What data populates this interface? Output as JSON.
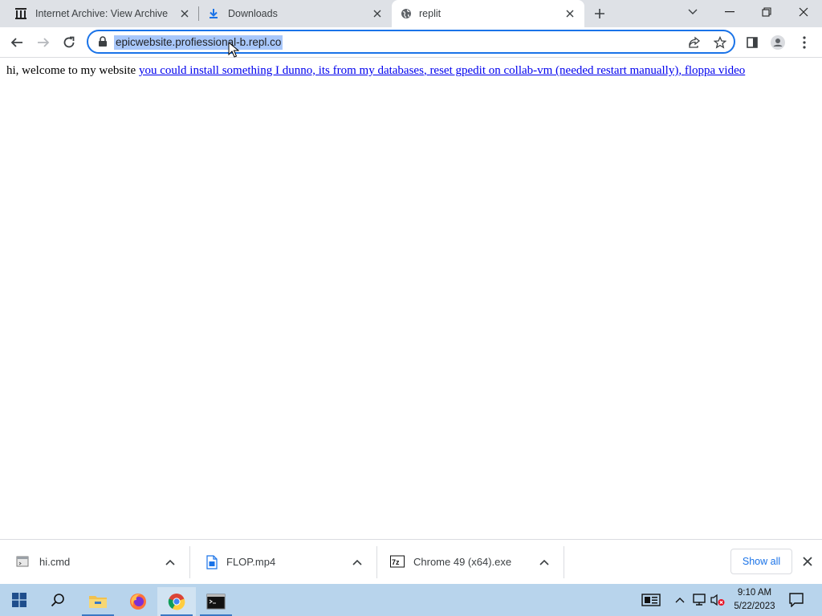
{
  "tabs": [
    {
      "title": "Internet Archive: View Archive",
      "icon": "archive-icon"
    },
    {
      "title": "Downloads",
      "icon": "download-icon"
    },
    {
      "title": "replit",
      "icon": "globe-icon",
      "active": true
    }
  ],
  "address_bar": {
    "url": "epicwebsite.profiessional-b.repl.co",
    "selected": true
  },
  "page": {
    "intro_text": "hi, welcome to my website",
    "links": [
      "you could install something I dunno, its from my databases",
      "reset gpedit on collab-vm (needed restart manually)",
      "floppa video"
    ],
    "separator": ", "
  },
  "downloads": [
    {
      "name": "hi.cmd",
      "icon": "cmd-file-icon"
    },
    {
      "name": "FLOP.mp4",
      "icon": "video-file-icon"
    },
    {
      "name": "Chrome 49 (x64).exe",
      "icon": "7zip-file-icon"
    }
  ],
  "shelf": {
    "show_all_label": "Show all"
  },
  "taskbar": {
    "time": "9:10 AM",
    "date": "5/22/2023"
  },
  "colors": {
    "accent": "#1a73e8",
    "selection": "#a8c7fa",
    "link": "#0000ee",
    "taskbar": "#b8d4ec",
    "tabstrip": "#dee1e6"
  }
}
